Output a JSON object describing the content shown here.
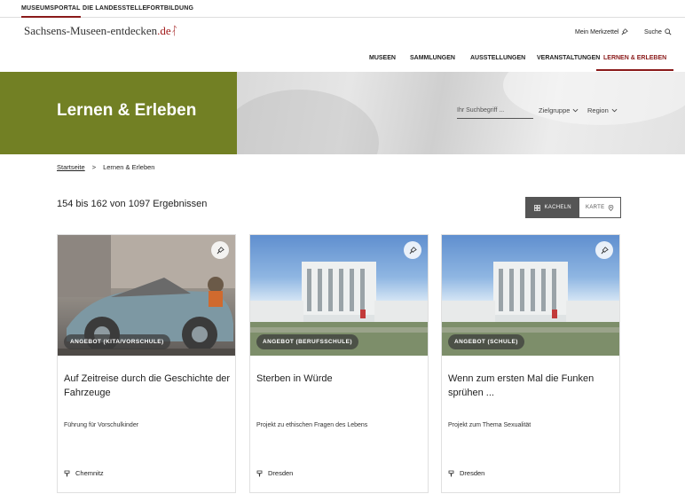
{
  "topbar": {
    "items": [
      {
        "label": "MUSEUMSPORTAL",
        "active": true
      },
      {
        "label": "DIE LANDESSTELLE",
        "active": false
      },
      {
        "label": "FORTBILDUNG",
        "active": false
      }
    ]
  },
  "header": {
    "logo_main": "Sachsens-Museen-entdecken",
    "logo_tld": ".de",
    "merkzettel_label": "Mein Merkzettel",
    "search_label": "Suche"
  },
  "nav": {
    "items": [
      {
        "label": "MUSEEN"
      },
      {
        "label": "SAMMLUNGEN"
      },
      {
        "label": "AUSSTELLUNGEN"
      },
      {
        "label": "VERANSTALTUNGEN"
      },
      {
        "label": "LERNEN & ERLEBEN",
        "active": true
      }
    ]
  },
  "hero": {
    "title": "Lernen & Erleben",
    "search_placeholder": "Ihr Suchbegriff ...",
    "filter_target": "Zielgruppe",
    "filter_region": "Region"
  },
  "breadcrumb": {
    "home": "Startseite",
    "separator": ">",
    "current": "Lernen & Erleben"
  },
  "results_text": "154 bis 162 von 1097 Ergebnissen",
  "view_toggle": {
    "tiles_label": "KACHELN",
    "map_label": "KARTE"
  },
  "colors": {
    "accent": "#8a1a1a",
    "hero_green": "#728024"
  },
  "cards": [
    {
      "tag": "ANGEBOT (KITA/VORSCHULE)",
      "title": "Auf Zeitreise durch die Geschichte der Fahrzeuge",
      "subtitle": "Führung für Vorschulkinder",
      "location": "Chemnitz"
    },
    {
      "tag": "ANGEBOT (BERUFSSCHULE)",
      "title": "Sterben in Würde",
      "subtitle": "Projekt zu ethischen Fragen des Lebens",
      "location": "Dresden"
    },
    {
      "tag": "ANGEBOT (SCHULE)",
      "title": "Wenn zum ersten Mal die Funken sprühen ...",
      "subtitle": "Projekt zum Thema Sexualität",
      "location": "Dresden"
    }
  ]
}
